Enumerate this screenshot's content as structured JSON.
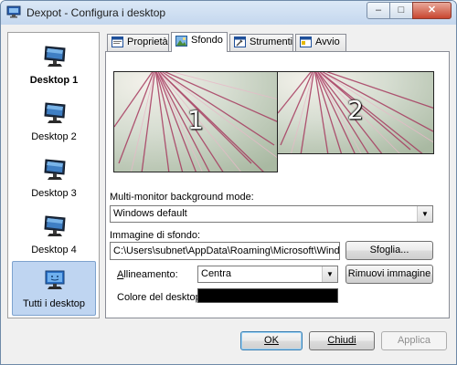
{
  "window": {
    "title": "Dexpot - Configura i desktop",
    "controls": {
      "minimize": "–",
      "maximize": "□",
      "close": "✕"
    }
  },
  "sidebar": {
    "items": [
      {
        "label": "Desktop 1",
        "icon": "monitor-icon",
        "active": true
      },
      {
        "label": "Desktop 2",
        "icon": "monitor-icon"
      },
      {
        "label": "Desktop 3",
        "icon": "monitor-icon"
      },
      {
        "label": "Desktop 4",
        "icon": "monitor-icon"
      },
      {
        "label": "Tutti i desktop",
        "icon": "monitor-face-icon",
        "selected": true
      }
    ]
  },
  "tabs": [
    {
      "label": "Proprietà",
      "icon": "properties-icon"
    },
    {
      "label": "Sfondo",
      "icon": "wallpaper-icon",
      "active": true
    },
    {
      "label": "Strumenti",
      "icon": "tools-icon"
    },
    {
      "label": "Avvio",
      "icon": "startup-icon"
    }
  ],
  "previews": [
    {
      "number": "1"
    },
    {
      "number": "2"
    }
  ],
  "form": {
    "multimonitor_label": "Multi-monitor background mode:",
    "multimonitor_value": "Windows default",
    "image_label": "Immagine di sfondo:",
    "image_path": "C:\\Users\\subnet\\AppData\\Roaming\\Microsoft\\Windows\\Th",
    "browse_button": "Sfoglia...",
    "alignment_label_prefix": "A",
    "alignment_label_rest": "llineamento:",
    "alignment_value": "Centra",
    "remove_image_button": "Rimuovi immagine",
    "color_label": "Colore del desktop:",
    "desktop_color": "#000000"
  },
  "footer": {
    "ok": "OK",
    "close": "Chiudi",
    "apply": "Applica"
  },
  "colors": {
    "selection_bg": "#bfd5f1",
    "titlebar": "#c4d7ee",
    "close_button": "#c8452f"
  }
}
